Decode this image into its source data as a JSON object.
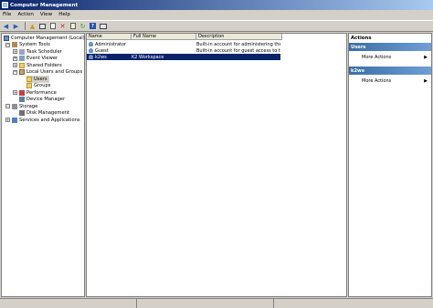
{
  "window": {
    "title": "Computer Management"
  },
  "menu": [
    "File",
    "Action",
    "View",
    "Help"
  ],
  "toolbar": [
    "back-icon",
    "forward-icon",
    "up-icon",
    "show-hide-tree-icon",
    "properties-icon",
    "delete-icon",
    "export-icon",
    "refresh-icon",
    "help-icon",
    "show-hide-action-pane-icon"
  ],
  "tree": [
    {
      "label": "Computer Management (Local)",
      "icon": "computer-icon",
      "level": 0,
      "toggle": ""
    },
    {
      "label": "System Tools",
      "icon": "tools-icon",
      "level": 1,
      "toggle": "−"
    },
    {
      "label": "Task Scheduler",
      "icon": "task-scheduler-icon",
      "level": 2,
      "toggle": "+"
    },
    {
      "label": "Event Viewer",
      "icon": "event-viewer-icon",
      "level": 2,
      "toggle": "+"
    },
    {
      "label": "Shared Folders",
      "icon": "folder-icon",
      "level": 2,
      "toggle": "+"
    },
    {
      "label": "Local Users and Groups",
      "icon": "users-icon",
      "level": 2,
      "toggle": "−"
    },
    {
      "label": "Users",
      "icon": "folder-icon",
      "level": 3,
      "toggle": ""
    },
    {
      "label": "Groups",
      "icon": "folder-icon",
      "level": 3,
      "toggle": ""
    },
    {
      "label": "Performance",
      "icon": "performance-icon",
      "level": 2,
      "toggle": "+"
    },
    {
      "label": "Device Manager",
      "icon": "device-manager-icon",
      "level": 2,
      "toggle": ""
    },
    {
      "label": "Storage",
      "icon": "storage-icon",
      "level": 1,
      "toggle": "−"
    },
    {
      "label": "Disk Management",
      "icon": "disk-icon",
      "level": 2,
      "toggle": ""
    },
    {
      "label": "Services and Applications",
      "icon": "services-icon",
      "level": 1,
      "toggle": "+"
    }
  ],
  "list": {
    "columns": [
      "Name",
      "Full Name",
      "Description"
    ],
    "rows": [
      {
        "name": "Administrator",
        "full_name": "",
        "description": "Built-in account for administering the..."
      },
      {
        "name": "Guest",
        "full_name": "",
        "description": "Built-in account for guest access to t..."
      },
      {
        "name": "k2ws",
        "full_name": "K2 Workspace",
        "description": ""
      }
    ]
  },
  "actions": {
    "title": "Actions",
    "sections": [
      {
        "header": "Users",
        "items": [
          "More Actions"
        ]
      },
      {
        "header": "k2ws",
        "items": [
          "More Actions"
        ]
      }
    ]
  }
}
